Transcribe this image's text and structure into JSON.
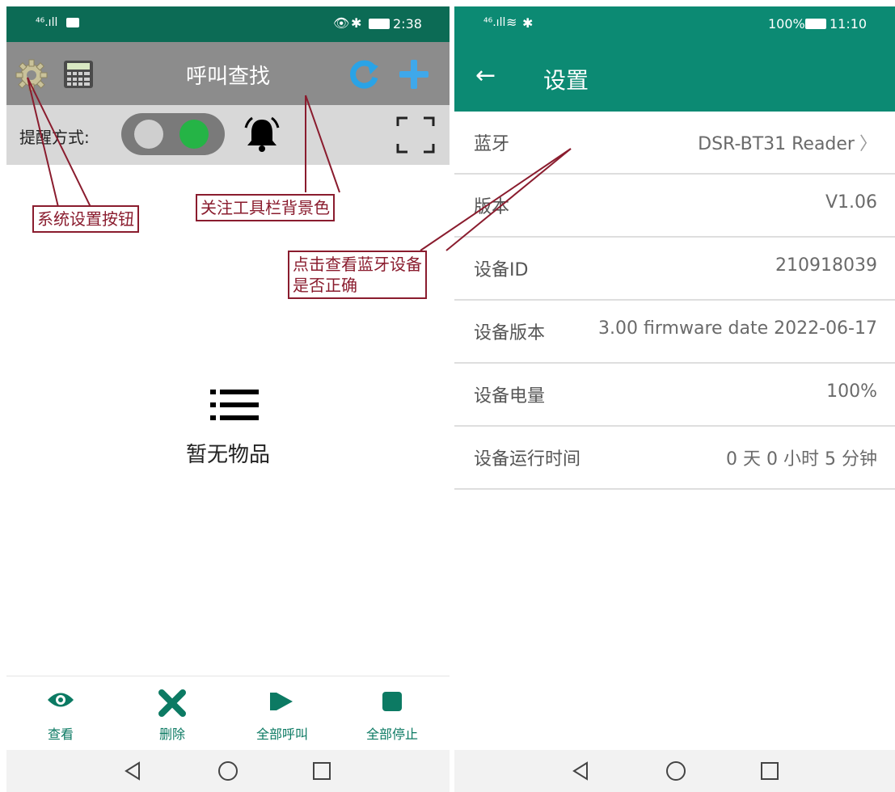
{
  "left": {
    "status": {
      "left_signal": "⁴⁶.ıll",
      "right": "2:38"
    },
    "toolbar": {
      "title": "呼叫查找"
    },
    "remind": {
      "label": "提醒方式:"
    },
    "empty_text": "暂无物品",
    "bottom_actions": [
      {
        "label": "查看",
        "icon": "eye-icon"
      },
      {
        "label": "删除",
        "icon": "close-icon"
      },
      {
        "label": "全部呼叫",
        "icon": "play-icon"
      },
      {
        "label": "全部停止",
        "icon": "stop-icon"
      }
    ],
    "annotations": {
      "settings_button": "系统设置按钮",
      "toolbar_bg": "关注工具栏背景色",
      "bluetooth_check_line1": "点击查看蓝牙设备",
      "bluetooth_check_line2": "是否正确"
    }
  },
  "right": {
    "status": {
      "left_signal": "⁴⁶.ıll",
      "battery": "100%",
      "time": "11:10"
    },
    "appbar": {
      "title": "设置",
      "back": "←"
    },
    "rows": [
      {
        "key": "蓝牙",
        "value": "DSR-BT31 Reader"
      },
      {
        "key": "版本",
        "value": "V1.06"
      },
      {
        "key": "设备ID",
        "value": "210918039"
      },
      {
        "key": "设备版本",
        "value": "3.00 firmware date 2022-06-17"
      },
      {
        "key": "设备电量",
        "value": "100%"
      },
      {
        "key": "设备运行时间",
        "value": "0 天 0 小时 5 分钟"
      }
    ]
  },
  "colors": {
    "left_status": "#0c6b55",
    "right_accent": "#0c8a73",
    "toolbar_gray": "#8c8c8c",
    "annotation": "#8a1c2e"
  }
}
